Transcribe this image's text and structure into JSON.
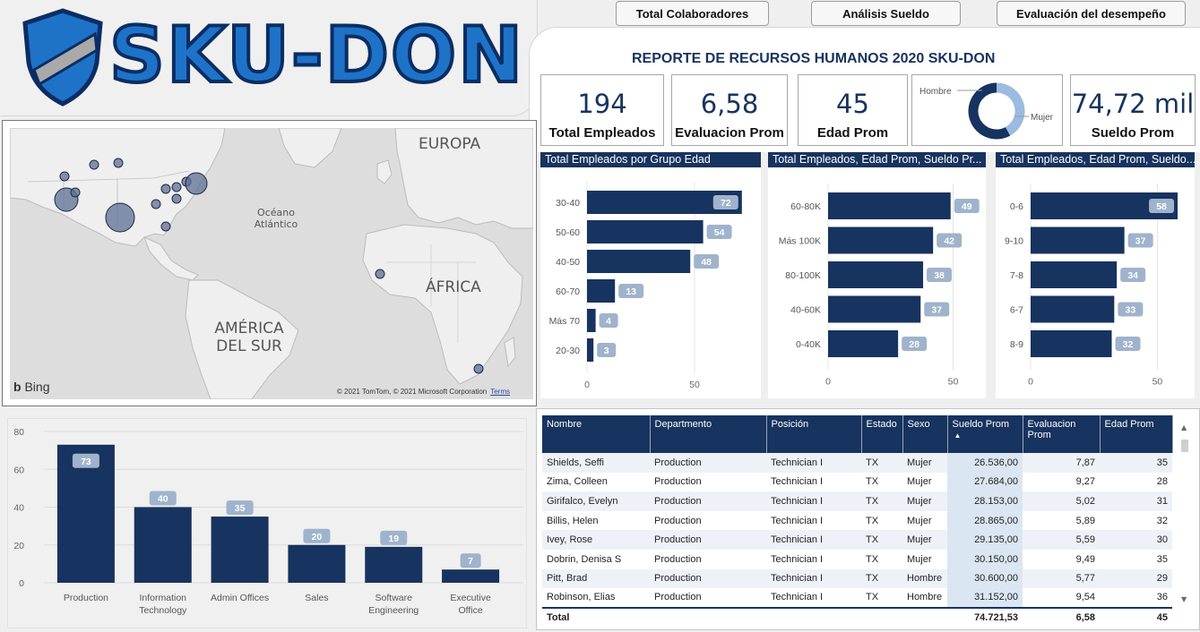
{
  "brand": {
    "name": "SKU-DON"
  },
  "nav": [
    {
      "label": "Total Colaboradores"
    },
    {
      "label": "Análisis Sueldo"
    },
    {
      "label": "Evaluación del desempeño"
    }
  ],
  "report_title": "REPORTE DE RECURSOS HUMANOS 2020 SKU-DON",
  "kpis": {
    "total_empleados": {
      "value": "194",
      "label": "Total Empleados"
    },
    "evaluacion": {
      "value": "6,58",
      "label": "Evaluacion Prom"
    },
    "edad": {
      "value": "45",
      "label": "Edad Prom"
    },
    "sueldo": {
      "value": "74,72 mil",
      "label": "Sueldo Prom"
    }
  },
  "gender_donut": {
    "labels": [
      "Hombre",
      "Mujer"
    ],
    "values": [
      0.42,
      0.58
    ],
    "colors": [
      "#9bbbe0",
      "#17335f"
    ]
  },
  "map": {
    "labels": [
      "EUROPA",
      "Océano Atlántico",
      "ÁFRICA",
      "AMÉRICA DEL SUR"
    ],
    "provider": "Bing",
    "copyright": "© 2021 TomTom, © 2021 Microsoft Corporation",
    "terms": "Terms"
  },
  "chart_data": [
    {
      "type": "bar",
      "orientation": "horizontal",
      "title": "Total Empleados por Grupo Edad",
      "categories": [
        "30-40",
        "50-60",
        "40-50",
        "60-70",
        "Más 70",
        "20-30"
      ],
      "values": [
        72,
        54,
        48,
        13,
        4,
        3
      ],
      "xlim": [
        0,
        80
      ],
      "xticks": [
        0,
        50
      ]
    },
    {
      "type": "bar",
      "orientation": "horizontal",
      "title": "Total Empleados, Edad Prom, Sueldo Pr...",
      "categories": [
        "60-80K",
        "Más 100K",
        "80-100K",
        "40-60K",
        "0-40K"
      ],
      "values": [
        49,
        42,
        38,
        37,
        28
      ],
      "xlim": [
        0,
        62
      ],
      "xticks": [
        0,
        50
      ]
    },
    {
      "type": "bar",
      "orientation": "horizontal",
      "title": "Total Empleados, Edad Prom, Sueldo...",
      "categories": [
        "0-6",
        "9-10",
        "7-8",
        "6-7",
        "8-9"
      ],
      "values": [
        58,
        37,
        34,
        33,
        32
      ],
      "xlim": [
        0,
        64
      ],
      "xticks": [
        0,
        50
      ]
    },
    {
      "type": "bar",
      "orientation": "vertical",
      "title": "",
      "categories": [
        "Production",
        "Information Technology",
        "Admin Offices",
        "Sales",
        "Software Engineering",
        "Executive Office"
      ],
      "category_lines": [
        [
          "Production"
        ],
        [
          "Information",
          "Technology"
        ],
        [
          "Admin Offices"
        ],
        [
          "Sales"
        ],
        [
          "Software",
          "Engineering"
        ],
        [
          "Executive",
          "Office"
        ]
      ],
      "values": [
        73,
        40,
        35,
        20,
        19,
        7
      ],
      "ylim": [
        0,
        80
      ],
      "yticks": [
        0,
        20,
        40,
        60,
        80
      ]
    }
  ],
  "table": {
    "columns": [
      "Nombre",
      "Departmento",
      "Posición",
      "Estado",
      "Sexo",
      "Sueldo Prom",
      "Evaluacion Prom",
      "Edad Prom"
    ],
    "rows": [
      [
        "Shields, Seffi",
        "Production",
        "Technician I",
        "TX",
        "Mujer",
        "26.536,00",
        "7,87",
        "35"
      ],
      [
        "Zima, Colleen",
        "Production",
        "Technician I",
        "TX",
        "Mujer",
        "27.684,00",
        "9,27",
        "28"
      ],
      [
        "Girifalco, Evelyn",
        "Production",
        "Technician I",
        "TX",
        "Mujer",
        "28.153,00",
        "5,02",
        "31"
      ],
      [
        "Billis, Helen",
        "Production",
        "Technician I",
        "TX",
        "Mujer",
        "28.865,00",
        "5,89",
        "32"
      ],
      [
        "Ivey, Rose",
        "Production",
        "Technician I",
        "TX",
        "Mujer",
        "29.135,00",
        "5,59",
        "30"
      ],
      [
        "Dobrin, Denisa S",
        "Production",
        "Technician I",
        "TX",
        "Mujer",
        "30.150,00",
        "9,49",
        "35"
      ],
      [
        "Pitt, Brad",
        "Production",
        "Technician I",
        "TX",
        "Hombre",
        "30.600,00",
        "5,77",
        "29"
      ],
      [
        "Robinson, Elias",
        "Production",
        "Technician I",
        "TX",
        "Hombre",
        "31.152,00",
        "9,54",
        "36"
      ]
    ],
    "total": [
      "Total",
      "",
      "",
      "",
      "",
      "74.721,53",
      "6,58",
      "45"
    ]
  },
  "colors": {
    "navy": "#17335f",
    "badge": "#9fb3cc",
    "accent": "#1e73c8"
  }
}
